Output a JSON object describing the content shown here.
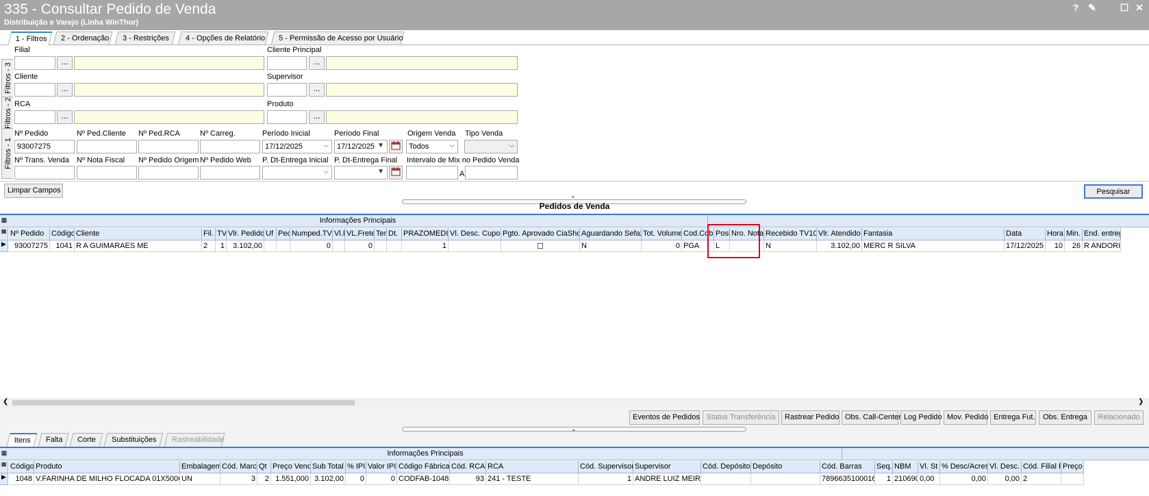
{
  "window": {
    "title": "335 - Consultar Pedido de Venda",
    "subtitle": "Distribuição e Varejo (Linha WinThor)",
    "help": "?",
    "edit": "✎",
    "maximize": "☐",
    "close": "✕"
  },
  "top_tabs": [
    "1 - Filtros",
    "2 - Ordenação",
    "3 - Restrições",
    "4 - Opções de Relatório",
    "5 - Permissão de Acesso por Usuário"
  ],
  "side_tabs": [
    "Filtros - 1",
    "Filtros - 2",
    "Filtros - 3"
  ],
  "filters": {
    "filial_label": "Filial",
    "cliente_principal_label": "Cliente Principal",
    "cliente_label": "Cliente",
    "supervisor_label": "Supervisor",
    "rca_label": "RCA",
    "produto_label": "Produto",
    "dots": "...",
    "nr_pedido_label": "Nº Pedido",
    "nr_pedido_value": "93007275",
    "nr_ped_cliente_label": "Nº Ped.Cliente",
    "nr_ped_rca_label": "Nº Ped.RCA",
    "nr_carreg_label": "Nº Carreg.",
    "periodo_inicial_label": "Período Inicial",
    "periodo_inicial_value": "17/12/2025",
    "periodo_final_label": "Período Final",
    "periodo_final_value": "17/12/2025",
    "origem_venda_label": "Origem Venda",
    "origem_venda_value": "Todos",
    "tipo_venda_label": "Tipo Venda",
    "nr_trans_venda_label": "Nº Trans. Venda",
    "nr_nota_fiscal_label": "Nº Nota Fiscal",
    "nr_pedido_origem_label": "Nº Pedido Origem",
    "nr_pedido_web_label": "Nº Pedido Web",
    "p_dt_entrega_inicial_label": "P. Dt-Entrega Inicial",
    "p_dt_entrega_final_label": "P. Dt-Entrega Final",
    "intervalo_mix_label": "Intervalo de Mix no Pedido Venda",
    "intervalo_a": "A"
  },
  "buttons": {
    "limpar": "Limpar Campos",
    "pesquisar": "Pesquisar",
    "eventos": "Eventos de Pedidos",
    "status_transf": "Status Transferência",
    "rastrear": "Rastrear Pedido",
    "obs_call": "Obs. Call-Center",
    "log": "Log Pedido",
    "mov": "Mov. Pedido",
    "entrega_fut": "Entrega Fut.",
    "obs_entrega": "Obs. Entrega",
    "relacionado": "Relacionado"
  },
  "orders_grid": {
    "title": "Pedidos de  Venda",
    "band": "Informações Principais",
    "columns": [
      "Nº Pedido",
      "Código",
      "Cliente",
      "Fil.",
      "TV",
      "Vlr. Pedido",
      "Uf",
      "Pec",
      "Numped.TV7",
      "Vl.E",
      "VL.Frete",
      "Ter",
      "Dt.",
      "PRAZOMEDIO",
      "Vl. Desc. Cupom",
      "Pgto. Aprovado CiaShop",
      "Aguardando Sefaz",
      "Tot. Volume",
      "Cod.Cob",
      "Posição",
      "Nro. Nota",
      "Recebido TV10",
      "Vlr. Atendido",
      "Fantasia",
      "Data",
      "Hora",
      "Min.",
      "End. entrega"
    ],
    "row": [
      "93007275",
      "1041",
      "R A GUIMARAES ME",
      "2",
      "1",
      "3.102,00",
      "",
      "",
      "0",
      "",
      "0",
      "",
      "",
      "1",
      "",
      "☐",
      "N",
      "0",
      "PGA",
      "L",
      "",
      "N",
      "3.102,00",
      "MERC R SILVA",
      "17/12/2025",
      "10",
      "26",
      "R ANDORINHA"
    ]
  },
  "bottom_tabs": [
    "Itens",
    "Falta",
    "Corte",
    "Substituições",
    "Rastreabilidade"
  ],
  "items_grid": {
    "band": "Informações Principais",
    "columns": [
      "Código",
      "Produto",
      "Embalagem",
      "Cód. Marca",
      "Qt",
      "Preço Venda",
      "Sub Total",
      "% IPI",
      "Valor IPI",
      "Código Fábrica",
      "Cód. RCA",
      "RCA",
      "Cód. Supervisor",
      "Supervisor",
      "Cód. Depósito",
      "Depósito",
      "Cód. Barras",
      "Seq.",
      "NBM",
      "Vl. St",
      "% Desc/Acresc",
      "Vl. Desc.",
      "Cód. Filial Retira",
      "Preço"
    ],
    "row": [
      "1048",
      "V.FARINHA DE MILHO FLOCADA 01X500G",
      "UN",
      "3",
      "2",
      "1.551,000",
      "3.102,00",
      "0",
      "0",
      "CODFAB-1048",
      "93",
      "241 - TESTE",
      "1",
      "ANDRE LUIZ MEIRA",
      "",
      "",
      "7896635100016",
      "1",
      "21069010",
      "0,00",
      "0,00",
      "0,00",
      "2",
      ""
    ]
  },
  "colors": {
    "titlebar": "#a7a7a7",
    "grid_header": "#dfe9f7",
    "accent": "#3c78d8",
    "highlight": "#e0001a",
    "field_yellow": "#fffde1"
  }
}
